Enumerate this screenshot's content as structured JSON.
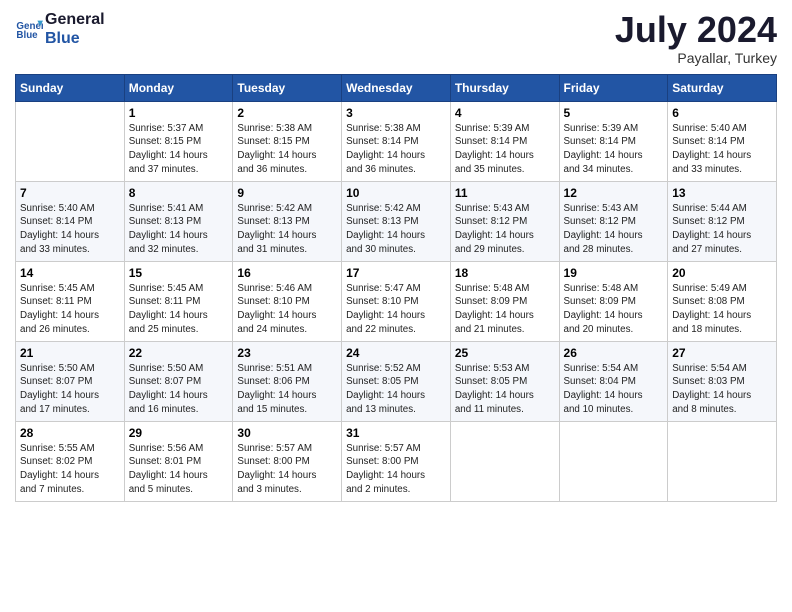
{
  "header": {
    "logo_line1": "General",
    "logo_line2": "Blue",
    "month_title": "July 2024",
    "subtitle": "Payallar, Turkey"
  },
  "weekdays": [
    "Sunday",
    "Monday",
    "Tuesday",
    "Wednesday",
    "Thursday",
    "Friday",
    "Saturday"
  ],
  "weeks": [
    [
      {
        "day": "",
        "info": ""
      },
      {
        "day": "1",
        "info": "Sunrise: 5:37 AM\nSunset: 8:15 PM\nDaylight: 14 hours\nand 37 minutes."
      },
      {
        "day": "2",
        "info": "Sunrise: 5:38 AM\nSunset: 8:15 PM\nDaylight: 14 hours\nand 36 minutes."
      },
      {
        "day": "3",
        "info": "Sunrise: 5:38 AM\nSunset: 8:14 PM\nDaylight: 14 hours\nand 36 minutes."
      },
      {
        "day": "4",
        "info": "Sunrise: 5:39 AM\nSunset: 8:14 PM\nDaylight: 14 hours\nand 35 minutes."
      },
      {
        "day": "5",
        "info": "Sunrise: 5:39 AM\nSunset: 8:14 PM\nDaylight: 14 hours\nand 34 minutes."
      },
      {
        "day": "6",
        "info": "Sunrise: 5:40 AM\nSunset: 8:14 PM\nDaylight: 14 hours\nand 33 minutes."
      }
    ],
    [
      {
        "day": "7",
        "info": "Sunrise: 5:40 AM\nSunset: 8:14 PM\nDaylight: 14 hours\nand 33 minutes."
      },
      {
        "day": "8",
        "info": "Sunrise: 5:41 AM\nSunset: 8:13 PM\nDaylight: 14 hours\nand 32 minutes."
      },
      {
        "day": "9",
        "info": "Sunrise: 5:42 AM\nSunset: 8:13 PM\nDaylight: 14 hours\nand 31 minutes."
      },
      {
        "day": "10",
        "info": "Sunrise: 5:42 AM\nSunset: 8:13 PM\nDaylight: 14 hours\nand 30 minutes."
      },
      {
        "day": "11",
        "info": "Sunrise: 5:43 AM\nSunset: 8:12 PM\nDaylight: 14 hours\nand 29 minutes."
      },
      {
        "day": "12",
        "info": "Sunrise: 5:43 AM\nSunset: 8:12 PM\nDaylight: 14 hours\nand 28 minutes."
      },
      {
        "day": "13",
        "info": "Sunrise: 5:44 AM\nSunset: 8:12 PM\nDaylight: 14 hours\nand 27 minutes."
      }
    ],
    [
      {
        "day": "14",
        "info": "Sunrise: 5:45 AM\nSunset: 8:11 PM\nDaylight: 14 hours\nand 26 minutes."
      },
      {
        "day": "15",
        "info": "Sunrise: 5:45 AM\nSunset: 8:11 PM\nDaylight: 14 hours\nand 25 minutes."
      },
      {
        "day": "16",
        "info": "Sunrise: 5:46 AM\nSunset: 8:10 PM\nDaylight: 14 hours\nand 24 minutes."
      },
      {
        "day": "17",
        "info": "Sunrise: 5:47 AM\nSunset: 8:10 PM\nDaylight: 14 hours\nand 22 minutes."
      },
      {
        "day": "18",
        "info": "Sunrise: 5:48 AM\nSunset: 8:09 PM\nDaylight: 14 hours\nand 21 minutes."
      },
      {
        "day": "19",
        "info": "Sunrise: 5:48 AM\nSunset: 8:09 PM\nDaylight: 14 hours\nand 20 minutes."
      },
      {
        "day": "20",
        "info": "Sunrise: 5:49 AM\nSunset: 8:08 PM\nDaylight: 14 hours\nand 18 minutes."
      }
    ],
    [
      {
        "day": "21",
        "info": "Sunrise: 5:50 AM\nSunset: 8:07 PM\nDaylight: 14 hours\nand 17 minutes."
      },
      {
        "day": "22",
        "info": "Sunrise: 5:50 AM\nSunset: 8:07 PM\nDaylight: 14 hours\nand 16 minutes."
      },
      {
        "day": "23",
        "info": "Sunrise: 5:51 AM\nSunset: 8:06 PM\nDaylight: 14 hours\nand 15 minutes."
      },
      {
        "day": "24",
        "info": "Sunrise: 5:52 AM\nSunset: 8:05 PM\nDaylight: 14 hours\nand 13 minutes."
      },
      {
        "day": "25",
        "info": "Sunrise: 5:53 AM\nSunset: 8:05 PM\nDaylight: 14 hours\nand 11 minutes."
      },
      {
        "day": "26",
        "info": "Sunrise: 5:54 AM\nSunset: 8:04 PM\nDaylight: 14 hours\nand 10 minutes."
      },
      {
        "day": "27",
        "info": "Sunrise: 5:54 AM\nSunset: 8:03 PM\nDaylight: 14 hours\nand 8 minutes."
      }
    ],
    [
      {
        "day": "28",
        "info": "Sunrise: 5:55 AM\nSunset: 8:02 PM\nDaylight: 14 hours\nand 7 minutes."
      },
      {
        "day": "29",
        "info": "Sunrise: 5:56 AM\nSunset: 8:01 PM\nDaylight: 14 hours\nand 5 minutes."
      },
      {
        "day": "30",
        "info": "Sunrise: 5:57 AM\nSunset: 8:00 PM\nDaylight: 14 hours\nand 3 minutes."
      },
      {
        "day": "31",
        "info": "Sunrise: 5:57 AM\nSunset: 8:00 PM\nDaylight: 14 hours\nand 2 minutes."
      },
      {
        "day": "",
        "info": ""
      },
      {
        "day": "",
        "info": ""
      },
      {
        "day": "",
        "info": ""
      }
    ]
  ]
}
